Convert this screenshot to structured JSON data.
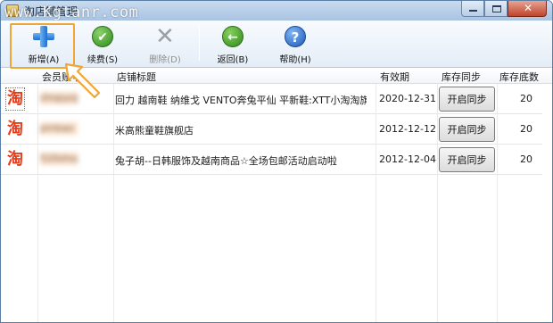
{
  "window": {
    "title": "淘店铺管理",
    "watermark": "www.Kgtanr.com",
    "buttons": {
      "minimize_icon": "minimize-icon",
      "maximize_icon": "maximize-icon",
      "close_symbol": "✕"
    }
  },
  "toolbar": {
    "buttons": [
      {
        "label": "新增(A)",
        "icon": "plus-icon",
        "enabled": true
      },
      {
        "label": "续费(S)",
        "icon": "check-icon",
        "enabled": true
      },
      {
        "label": "删除(D)",
        "icon": "delete-x-icon",
        "enabled": false
      },
      {
        "label": "返回(B)",
        "icon": "back-arrow-icon",
        "enabled": true
      },
      {
        "label": "帮助(H)",
        "icon": "help-icon",
        "enabled": true
      }
    ],
    "icon_glyphs": {
      "check": "✔",
      "x": "✕",
      "back": "←",
      "help": "?"
    }
  },
  "table": {
    "columns": [
      "会员账号",
      "店铺标题",
      "有效期",
      "库存同步",
      "库存底数"
    ],
    "row_icon_glyph": "淘",
    "rows": [
      {
        "account": "shopyojin",
        "title": "回力 越南鞋 纳维戈 VENTO奔兔平仙 平新鞋:XTT小淘淘旗…",
        "expiry": "2020-12-31",
        "sync_label": "开启同步",
        "stock": "20"
      },
      {
        "account": "pinbao",
        "title": "米高熊童鞋旗舰店",
        "expiry": "2012-12-12",
        "sync_label": "开启同步",
        "stock": "20"
      },
      {
        "account": "520shop",
        "title": "兔子胡--日韩服饰及越南商品☆全场包邮活动启动啦",
        "expiry": "2012-12-04",
        "sync_label": "开启同步",
        "stock": "20"
      }
    ]
  },
  "colors": {
    "highlight": "#f0a637",
    "taobao_orange": "#ea3a16",
    "titlebar": "#a8c3e2"
  }
}
